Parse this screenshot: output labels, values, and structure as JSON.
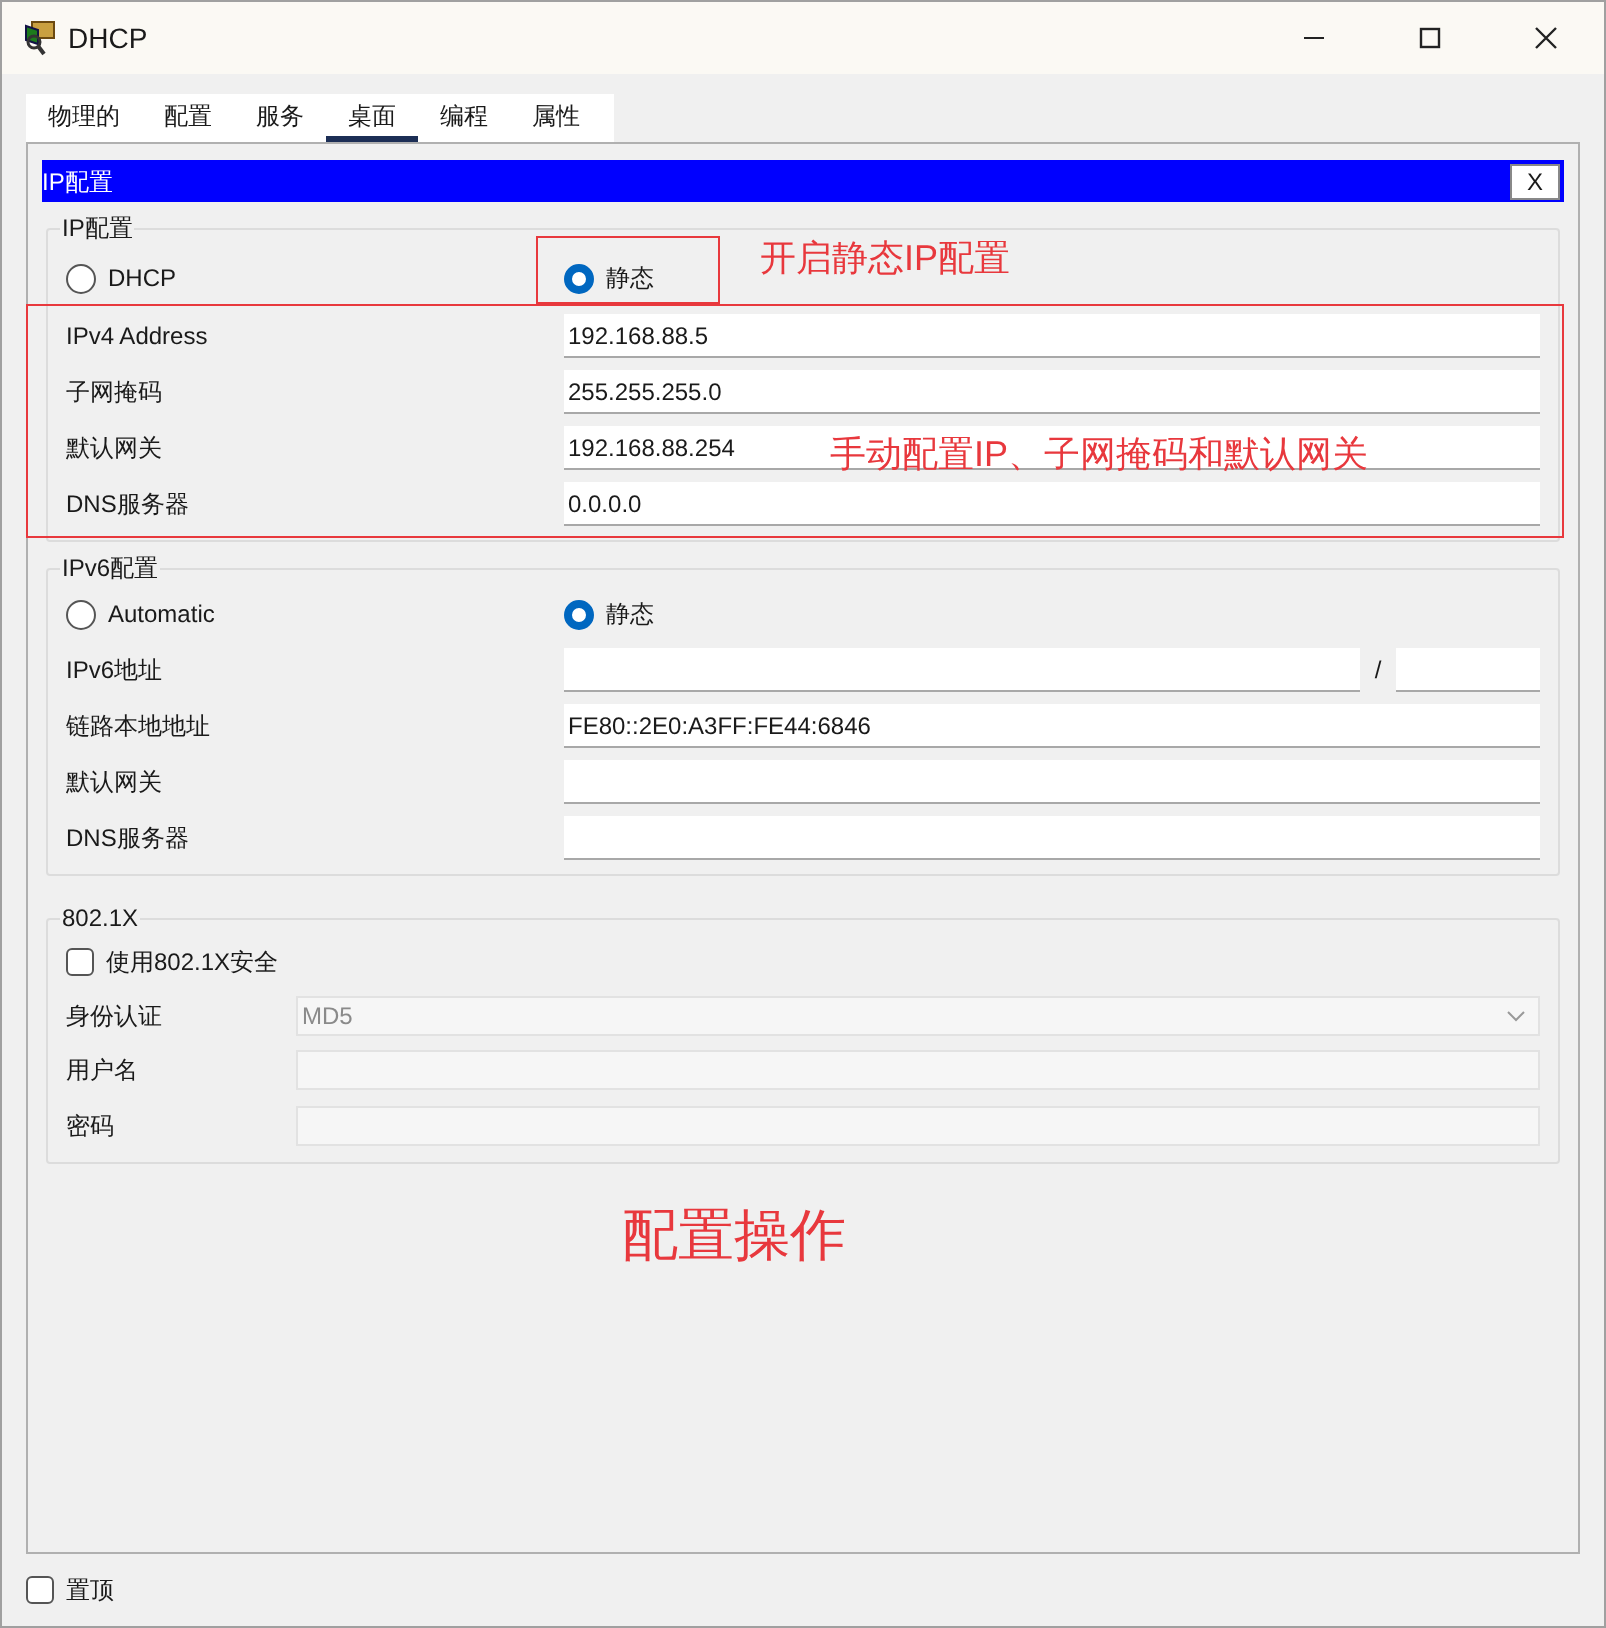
{
  "window": {
    "title": "DHCP"
  },
  "tabs": [
    {
      "label": "物理的",
      "selected": false
    },
    {
      "label": "配置",
      "selected": false
    },
    {
      "label": "服务",
      "selected": false
    },
    {
      "label": "桌面",
      "selected": true
    },
    {
      "label": "编程",
      "selected": false
    },
    {
      "label": "属性",
      "selected": false
    }
  ],
  "panel": {
    "title": "IP配置",
    "close_button": "X"
  },
  "ip_config": {
    "legend": "IP配置",
    "modes": [
      {
        "label": "DHCP",
        "selected": false,
        "highlighted": false
      },
      {
        "label": "静态",
        "selected": true,
        "highlighted": true,
        "note": "开启静态IP配置"
      }
    ],
    "fields_highlighted": true,
    "fields_note": "手动配置IP、子网掩码和默认网关",
    "fields": [
      {
        "label": "IPv4 Address",
        "value": "192.168.88.5"
      },
      {
        "label": "子网掩码",
        "value": "255.255.255.0"
      },
      {
        "label": "默认网关",
        "value": "192.168.88.254"
      },
      {
        "label": "DNS服务器",
        "value": "0.0.0.0"
      }
    ]
  },
  "ipv6_config": {
    "legend": "IPv6配置",
    "modes": [
      {
        "label": "Automatic",
        "selected": false
      },
      {
        "label": "静态",
        "selected": true
      }
    ],
    "address": {
      "label": "IPv6地址",
      "separator": "/"
    },
    "fields": [
      {
        "label": "链路本地地址",
        "value": "FE80::2E0:A3FF:FE44:6846"
      },
      {
        "label": "默认网关"
      },
      {
        "label": "DNS服务器"
      }
    ]
  },
  "dot1x": {
    "legend": "802.1X",
    "checkbox": {
      "label": "使用802.1X安全",
      "checked": false
    },
    "auth": {
      "label": "身份认证",
      "value": "MD5",
      "disabled": true
    },
    "fields": [
      {
        "label": "用户名",
        "disabled": true
      },
      {
        "label": "密码",
        "disabled": true
      }
    ]
  },
  "always_on_top": {
    "label": "置顶",
    "checked": false
  },
  "caption": "配置操作"
}
